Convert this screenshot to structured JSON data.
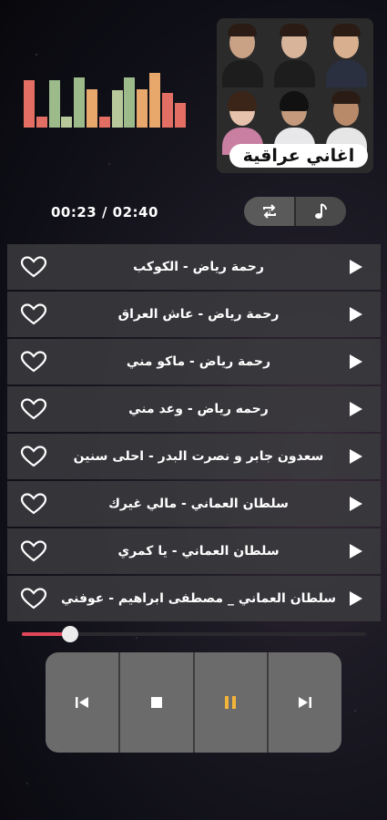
{
  "app": {
    "cover_banner": "اغاني عراقية",
    "time_display": "00:23 / 02:40"
  },
  "equalizer": {
    "levels": [
      0.86,
      0.2,
      0.86,
      0.2,
      0.91,
      0.7,
      0.2,
      0.68,
      0.91,
      0.7,
      1.0,
      0.63,
      0.45
    ],
    "colors": [
      "#e36f64",
      "#e36f64",
      "#9dba8b",
      "#b7c99a",
      "#9dba8b",
      "#e8a86c",
      "#e36f64",
      "#b7c99a",
      "#9dba8b",
      "#e8a86c",
      "#e8a86c",
      "#e36f64",
      "#e36f64"
    ]
  },
  "songs": [
    {
      "title": "رحمة رياض - الكوكب"
    },
    {
      "title": "رحمة رياض - عاش العراق"
    },
    {
      "title": "رحمة رياض - ماكو مني"
    },
    {
      "title": "رحمه رياض - وعد مني"
    },
    {
      "title": "سعدون جابر و نصرت البدر - احلى سنين"
    },
    {
      "title": "سلطان العماني - مالي غيرك"
    },
    {
      "title": "سلطان العماني - يا كمري"
    },
    {
      "title": "سلطان العماني _ مصطفى ابراهيم - عوفني"
    }
  ],
  "playback": {
    "progress_fraction": 0.14
  },
  "colors": {
    "accent_progress": "#e0465a",
    "pause_icon": "#f2b43a"
  },
  "icons": {
    "repeat": "repeat-icon",
    "music": "music-note-icon",
    "heart": "heart-outline-icon",
    "play": "play-icon",
    "previous": "skip-previous-icon",
    "stop": "stop-icon",
    "pause": "pause-icon",
    "next": "skip-next-icon"
  }
}
